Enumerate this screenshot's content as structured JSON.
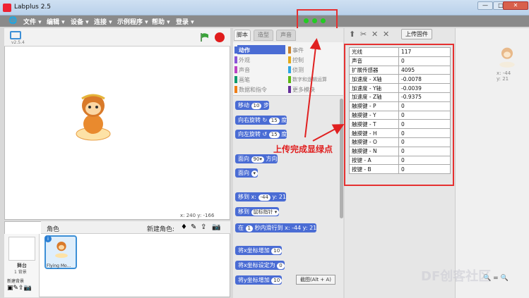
{
  "window": {
    "title": "Labplus 2.5",
    "controls": [
      "—",
      "□",
      "✕"
    ]
  },
  "menu": {
    "items": [
      "文件 ▾",
      "编辑 ▾",
      "设备 ▾",
      "连接 ▾",
      "示例程序 ▾",
      "帮助 ▾",
      "登录 ▾"
    ]
  },
  "stage": {
    "version": "v2.5.4",
    "coords": "x: 240  y: -166"
  },
  "sprites": {
    "header_label": "角色",
    "new_sprite_label": "新建角色:",
    "stage_label": "舞台",
    "stage_backdrops": "1 背景",
    "new_backdrop_label": "新建背景",
    "sprite_name": "Flying Mo..."
  },
  "tabs": [
    "脚本",
    "造型",
    "声音"
  ],
  "categories": [
    {
      "label": "动作",
      "color": "#4a6cd4",
      "active": true
    },
    {
      "label": "事件",
      "color": "#c88330"
    },
    {
      "label": "外观",
      "color": "#8a55d7"
    },
    {
      "label": "控制",
      "color": "#e1a91a"
    },
    {
      "label": "声音",
      "color": "#bb42c3"
    },
    {
      "label": "侦测",
      "color": "#2ca5e2"
    },
    {
      "label": "画笔",
      "color": "#0e9a6c"
    },
    {
      "label": "数字和逻辑运算",
      "color": "#5cb712"
    },
    {
      "label": "数据和指令",
      "color": "#ee7d16"
    },
    {
      "label": "更多模块",
      "color": "#632d99"
    }
  ],
  "blocks": [
    {
      "pre": "移动",
      "val": "10",
      "post": "步"
    },
    {
      "pre": "向右旋转 ↻",
      "val": "15",
      "post": "度"
    },
    {
      "pre": "向左旋转 ↺",
      "val": "15",
      "post": "度"
    },
    {
      "pre": "面向",
      "val": "90▾",
      "post": "方向"
    },
    {
      "pre": "面向",
      "val": "▾",
      "post": ""
    },
    {
      "pre": "移到 x:",
      "val": "-44",
      "post": "y: 21"
    },
    {
      "pre": "移到",
      "val": "鼠标指针 ▾",
      "post": ""
    },
    {
      "pre": "在",
      "val": "1",
      "post": "秒内滑行到 x: -44 y: 21"
    },
    {
      "pre": "将x坐标增加",
      "val": "10",
      "post": ""
    },
    {
      "pre": "将x坐标设定为",
      "val": "0",
      "post": ""
    },
    {
      "pre": "将y坐标增加",
      "val": "10",
      "post": ""
    }
  ],
  "toolbar": {
    "upload_label": "上传固件"
  },
  "sensors": [
    {
      "name": "光线",
      "value": "117"
    },
    {
      "name": "声音",
      "value": "0"
    },
    {
      "name": "扩展传感器",
      "value": "4095"
    },
    {
      "name": "加速度 - X轴",
      "value": "-0.0078"
    },
    {
      "name": "加速度 - Y轴",
      "value": "-0.0039"
    },
    {
      "name": "加速度 - Z轴",
      "value": "-0.9375"
    },
    {
      "name": "触摸键 - P",
      "value": "0"
    },
    {
      "name": "触摸键 - Y",
      "value": "0"
    },
    {
      "name": "触摸键 - T",
      "value": "0"
    },
    {
      "name": "触摸键 - H",
      "value": "0"
    },
    {
      "name": "触摸键 - O",
      "value": "0"
    },
    {
      "name": "触摸键 - N",
      "value": "0"
    },
    {
      "name": "按键 - A",
      "value": "0"
    },
    {
      "name": "按键 - B",
      "value": "0"
    }
  ],
  "annotation": "上传完成显绿点",
  "sprite_info": {
    "x": "x: -44",
    "y": "y: 21"
  },
  "screenshot_hint": "截图(Alt + A)",
  "watermark": "DF创客社区",
  "zoom": [
    "🔍",
    "=",
    "🔍"
  ]
}
